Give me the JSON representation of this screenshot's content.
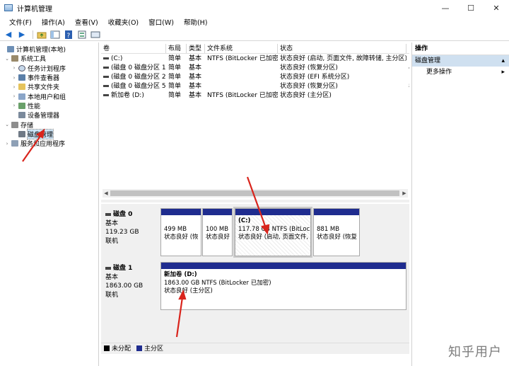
{
  "window": {
    "title": "计算机管理",
    "controls": [
      "—",
      "☐",
      "✕"
    ]
  },
  "menu": [
    "文件(F)",
    "操作(A)",
    "查看(V)",
    "收藏夹(O)",
    "窗口(W)",
    "帮助(H)"
  ],
  "tree": {
    "root": "计算机管理(本地)",
    "system_tools": "系统工具",
    "task_scheduler": "任务计划程序",
    "event_viewer": "事件查看器",
    "shared_folders": "共享文件夹",
    "local_users": "本地用户和组",
    "performance": "性能",
    "device_manager": "设备管理器",
    "storage": "存储",
    "disk_management": "磁盘管理",
    "services": "服务和应用程序"
  },
  "columns": [
    "卷",
    "布局",
    "类型",
    "文件系统",
    "状态"
  ],
  "volumes": [
    {
      "vol": "(C:)",
      "layout": "简单",
      "type": "基本",
      "fs": "NTFS (BitLocker 已加密)",
      "status": "状态良好 (启动, 页面文件, 故障转储, 主分区)",
      "extra": ""
    },
    {
      "vol": "(磁盘 0 磁盘分区 1)",
      "layout": "简单",
      "type": "基本",
      "fs": "",
      "status": "状态良好 (恢复分区)",
      "extra": "4"
    },
    {
      "vol": "(磁盘 0 磁盘分区 2)",
      "layout": "简单",
      "type": "基本",
      "fs": "",
      "status": "状态良好 (EFI 系统分区)",
      "extra": "1"
    },
    {
      "vol": "(磁盘 0 磁盘分区 5)",
      "layout": "简单",
      "type": "基本",
      "fs": "",
      "status": "状态良好 (恢复分区)",
      "extra": "8"
    },
    {
      "vol": "新加卷 (D:)",
      "layout": "简单",
      "type": "基本",
      "fs": "NTFS (BitLocker 已加密)",
      "status": "状态良好 (主分区)",
      "extra": ""
    }
  ],
  "disk0": {
    "name": "磁盘 0",
    "type": "基本",
    "size": "119.23 GB",
    "state": "联机",
    "partitions": [
      {
        "title": "",
        "line1": "499 MB",
        "line2": "状态良好 (恢"
      },
      {
        "title": "",
        "line1": "100 MB",
        "line2": "状态良好"
      },
      {
        "title": "(C:)",
        "line1": "117.78 GB NTFS (BitLocke",
        "line2": "状态良好 (启动, 页面文件,"
      },
      {
        "title": "",
        "line1": "881 MB",
        "line2": "状态良好 (恢复"
      }
    ]
  },
  "disk1": {
    "name": "磁盘 1",
    "type": "基本",
    "size": "1863.00 GB",
    "state": "联机",
    "partition": {
      "title": "新加卷 (D:)",
      "line1": "1863.00 GB NTFS (BitLocker 已加密)",
      "line2": "状态良好 (主分区)"
    }
  },
  "legend": {
    "unallocated": "未分配",
    "primary": "主分区"
  },
  "actions": {
    "header": "操作",
    "section": "磁盘管理",
    "more": "更多操作"
  },
  "watermark": "知乎用户",
  "colors": {
    "primary_partition": "#1f2c8f",
    "unallocated": "#000000",
    "annotation": "#d9241c"
  }
}
